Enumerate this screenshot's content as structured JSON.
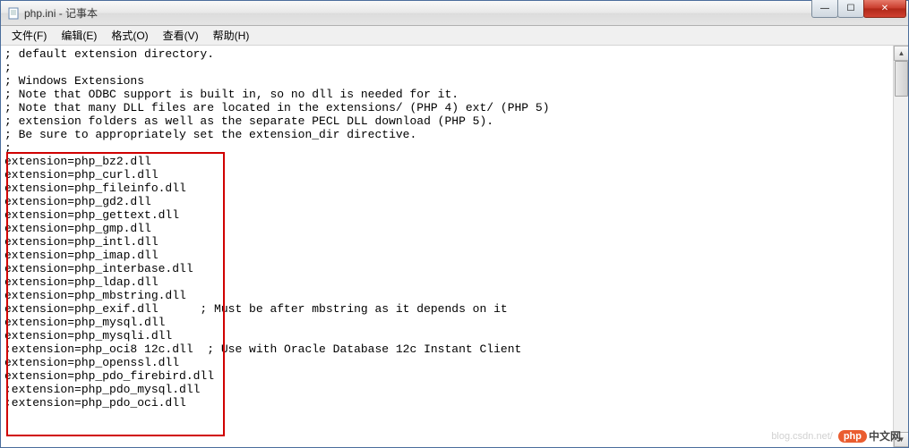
{
  "window": {
    "title": "php.ini - 记事本"
  },
  "menu": {
    "file": "文件(F)",
    "edit": "编辑(E)",
    "format": "格式(O)",
    "view": "查看(V)",
    "help": "帮助(H)"
  },
  "content": {
    "lines": [
      "; default extension directory.",
      ";",
      "; Windows Extensions",
      "; Note that ODBC support is built in, so no dll is needed for it.",
      "; Note that many DLL files are located in the extensions/ (PHP 4) ext/ (PHP 5)",
      "; extension folders as well as the separate PECL DLL download (PHP 5).",
      "; Be sure to appropriately set the extension_dir directive.",
      ";",
      "extension=php_bz2.dll",
      "extension=php_curl.dll",
      "extension=php_fileinfo.dll",
      "extension=php_gd2.dll",
      "extension=php_gettext.dll",
      "extension=php_gmp.dll",
      "extension=php_intl.dll",
      "extension=php_imap.dll",
      "extension=php_interbase.dll",
      "extension=php_ldap.dll",
      "extension=php_mbstring.dll",
      "extension=php_exif.dll      ; Must be after mbstring as it depends on it",
      "extension=php_mysql.dll",
      "extension=php_mysqli.dll",
      ";extension=php_oci8 12c.dll  ; Use with Oracle Database 12c Instant Client",
      "extension=php_openssl.dll",
      "extension=php_pdo_firebird.dll",
      ";extension=php_pdo_mysql.dll",
      ";extension=php_pdo_oci.dll"
    ]
  },
  "watermark": {
    "faint": "blog.csdn.net/",
    "logo": "php",
    "text": "中文网"
  },
  "glyphs": {
    "min": "—",
    "max": "☐",
    "close": "✕",
    "up": "▲",
    "down": "▼"
  }
}
